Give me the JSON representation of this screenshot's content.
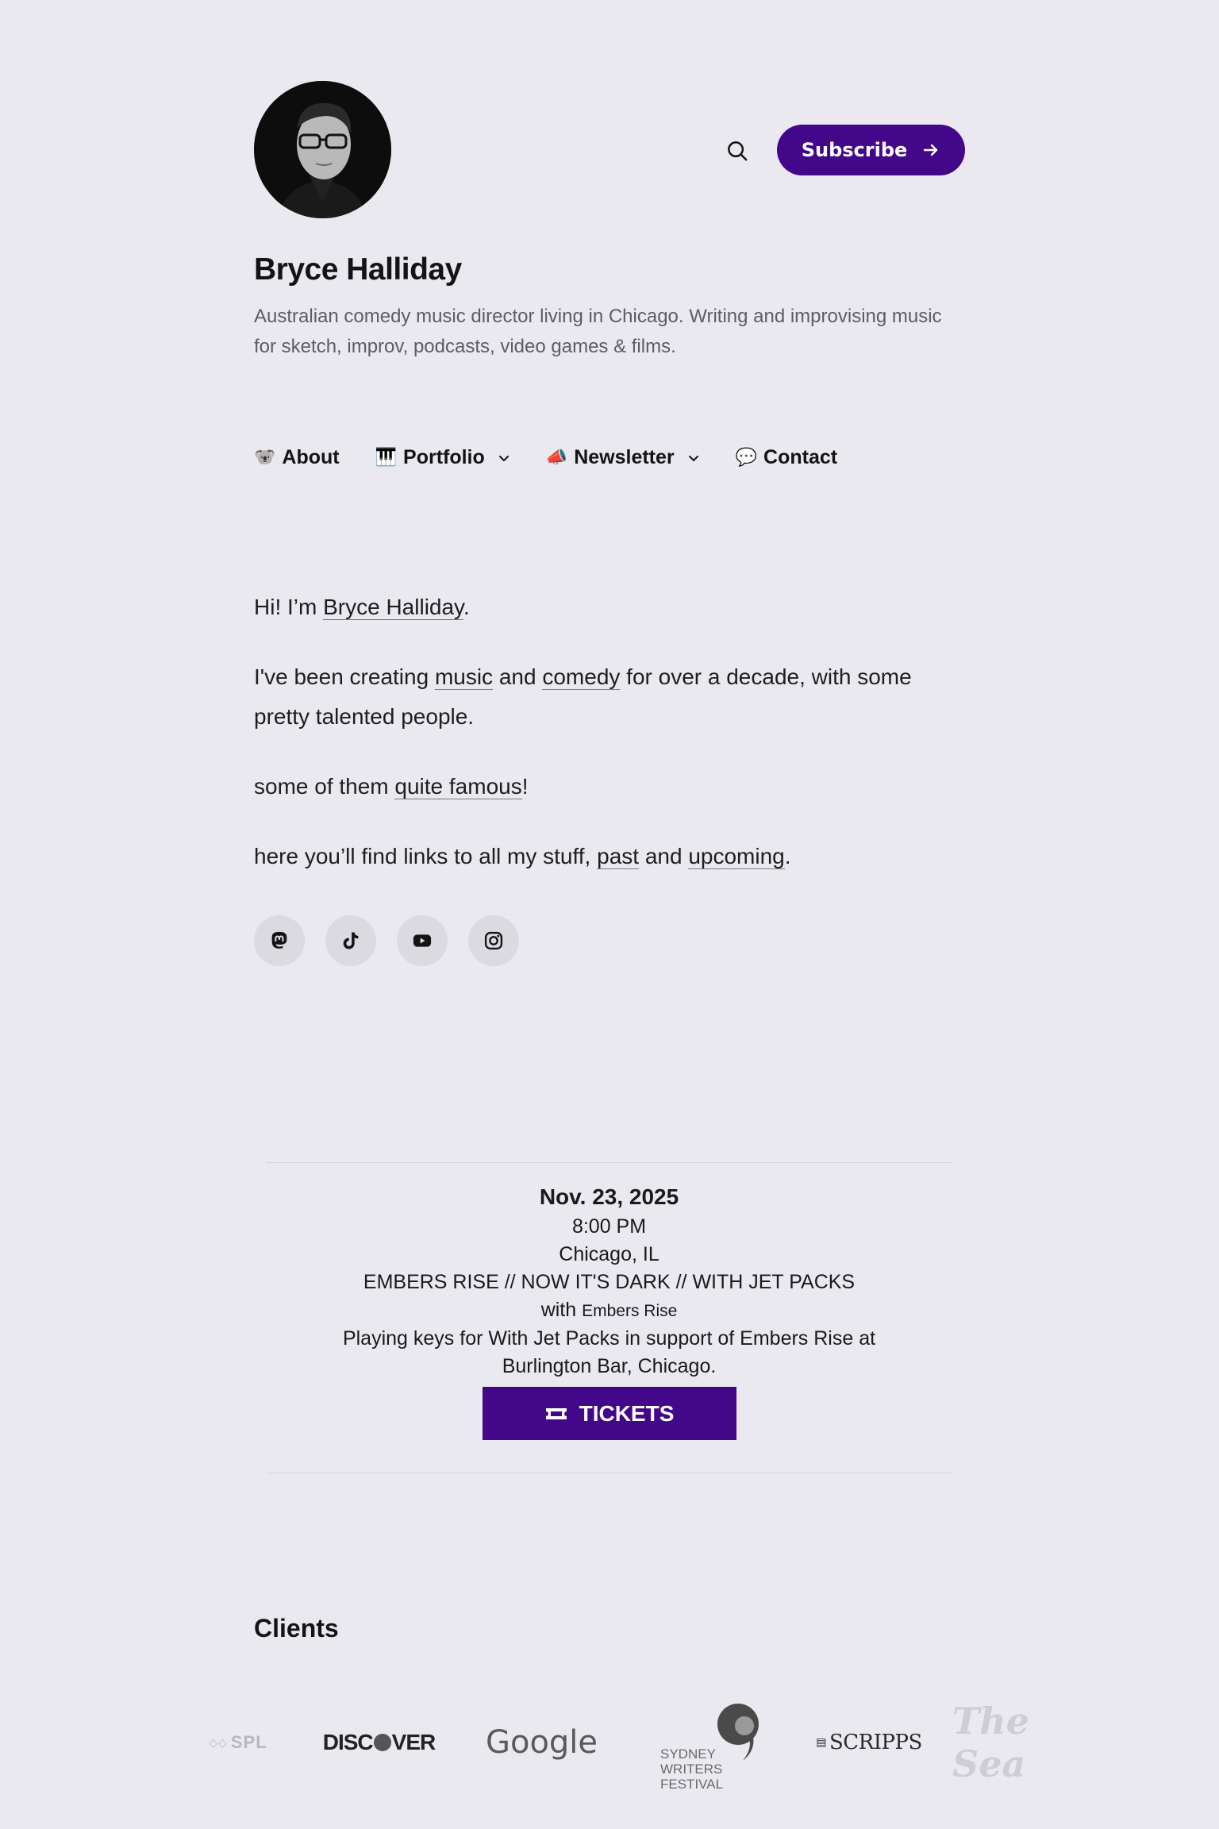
{
  "header": {
    "site_title": "Bryce Halliday",
    "tagline": "Australian comedy music director living in Chicago. Writing and improvising music for sketch, improv, podcasts, video games & films.",
    "subscribe_label": "Subscribe",
    "accent_color": "#43078a"
  },
  "nav": {
    "items": [
      {
        "emoji": "🐨",
        "label": "About",
        "has_dropdown": false
      },
      {
        "emoji": "🎹",
        "label": "Portfolio",
        "has_dropdown": true
      },
      {
        "emoji": "📣",
        "label": "Newsletter",
        "has_dropdown": true
      },
      {
        "emoji": "💬",
        "label": "Contact",
        "has_dropdown": false
      }
    ]
  },
  "intro": {
    "p1_pre": "Hi! I’m ",
    "p1_link": "Bryce Halliday",
    "p1_post": ".",
    "p2_pre": "I've been creating ",
    "p2_link1": "music",
    "p2_mid": " and ",
    "p2_link2": "comedy",
    "p2_post": " for over a decade, with some pretty talented people.",
    "p3_pre": "some of them ",
    "p3_link": "quite famous",
    "p3_post": "!",
    "p4_pre": "here you’ll find links to all my stuff, ",
    "p4_link1": "past",
    "p4_mid": " and ",
    "p4_link2": "upcoming",
    "p4_post": "."
  },
  "socials": [
    "mastodon-icon",
    "tiktok-icon",
    "youtube-icon",
    "instagram-icon"
  ],
  "event": {
    "date": "Nov. 23, 2025",
    "time": "8:00 PM",
    "location": "Chicago, IL",
    "title": "EMBERS RISE // NOW IT'S DARK // WITH JET PACKS",
    "with_prefix": "with",
    "with_name": "Embers Rise",
    "description": "Playing keys for With Jet Packs in support of Embers Rise at Burlington Bar, Chicago.",
    "tickets_label": "TICKETS"
  },
  "clients": {
    "title": "Clients",
    "logos": {
      "spl": "SPL",
      "discover_pre": "DISC",
      "discover_post": "VER",
      "google": "Google",
      "sydney": [
        "SYDNEY",
        "WRITERS",
        "FESTIVAL"
      ],
      "scripps": "SCRIPPS",
      "script": "The Sea"
    }
  }
}
